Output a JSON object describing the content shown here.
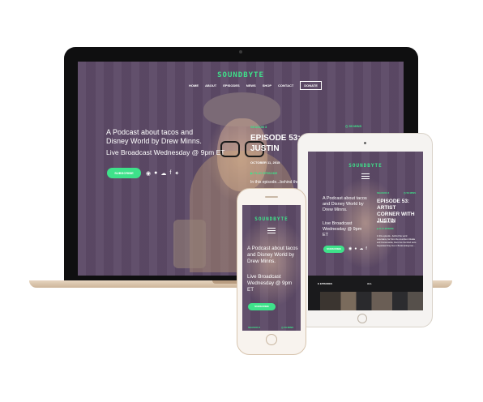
{
  "brand": {
    "logo": "SOUNDBYTE",
    "accent": "#3ee28a",
    "bg": "#5d4a67"
  },
  "nav": {
    "items": [
      "HOME",
      "ABOUT",
      "EPISODES",
      "NEWS",
      "SHOP",
      "CONTACT"
    ],
    "donate": "DONATE"
  },
  "laptop": {
    "tagline": "A Podcast about tacos and Disney World by Drew Minns.",
    "broadcast": "Live Broadcast Wednesday @ 9pm ET",
    "subscribe": "SUBSCRIBE",
    "season": "SEASON 3",
    "duration": "59 MINS",
    "episode_title": "EPISODE 53: ARTIST CORNER WITH JUSTIN",
    "date": "OCTOBER 11, 2015",
    "play": "PLAY EPISODE",
    "excerpt": "In this episode...behind the"
  },
  "tablet": {
    "tagline": "A Podcast about tacos and Disney World by Drew Minns.",
    "broadcast": "Live Broadcast Wednesday @ 9pm ET",
    "subscribe": "SUBSCRIBE",
    "season": "SEASON 3",
    "duration": "59 MINS",
    "episode_title": "EPISODE 53: ARTIST CORNER WITH JUSTIN",
    "date": "OCTOBER 11, 2015",
    "play": "PLAY EPISODE",
    "excerpt": "In this episode...behind the word mountains, far from the countries Vokalia and Consonantia, there live the blind texts. Separated they live in Bookmarksgrove...",
    "episodes_label": "E EPISODES",
    "all": "ALL"
  },
  "phone": {
    "tagline": "A Podcast about tacos and Disney World by Drew Minns.",
    "broadcast": "Live Broadcast Wednesday @ 9pm ET",
    "subscribe": "SUBSCRIBE",
    "season": "SEASON 3",
    "duration": "59 MINS"
  },
  "icons": [
    "rss-icon",
    "apple-icon",
    "soundcloud-icon",
    "facebook-icon",
    "twitter-icon"
  ]
}
